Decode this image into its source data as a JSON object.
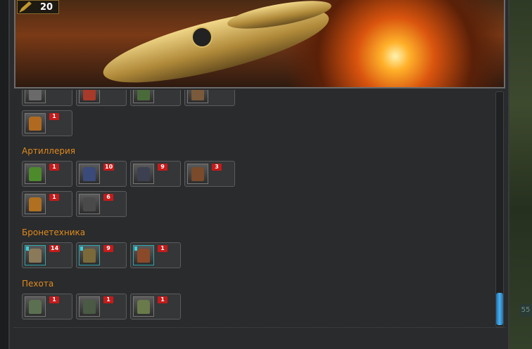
{
  "header": {
    "level": "20"
  },
  "sections": {
    "artillery": "Артиллерия",
    "armor": "Бронетехника",
    "infantry": "Пехота"
  },
  "units": {
    "partial_row": [
      {
        "icon": "mech-dark-icon",
        "count": ""
      },
      {
        "icon": "mech-red-icon",
        "count": ""
      },
      {
        "icon": "mech-green-icon",
        "count": ""
      },
      {
        "icon": "mech-brown-icon",
        "count": ""
      }
    ],
    "top_extra": [
      {
        "icon": "mech-orange-icon",
        "count": "1"
      }
    ],
    "artillery_row1": [
      {
        "icon": "green-walker-icon",
        "count": "1"
      },
      {
        "icon": "blue-mech-icon",
        "count": "10"
      },
      {
        "icon": "dark-mech-icon",
        "count": "9"
      },
      {
        "icon": "brown-mech-icon",
        "count": "3"
      }
    ],
    "artillery_row2": [
      {
        "icon": "orange-mech-icon",
        "count": "1"
      },
      {
        "icon": "gray-mech-icon",
        "count": "6"
      }
    ],
    "armor_row": [
      {
        "icon": "buggy-icon",
        "count": "14"
      },
      {
        "icon": "tank-icon",
        "count": "9"
      },
      {
        "icon": "apc-icon",
        "count": "1"
      }
    ],
    "infantry_row": [
      {
        "icon": "soldier-icon",
        "count": "1"
      },
      {
        "icon": "soldier-heavy-icon",
        "count": "1"
      },
      {
        "icon": "robot-icon",
        "count": "1"
      }
    ]
  },
  "side": {
    "mini_value": "55"
  }
}
